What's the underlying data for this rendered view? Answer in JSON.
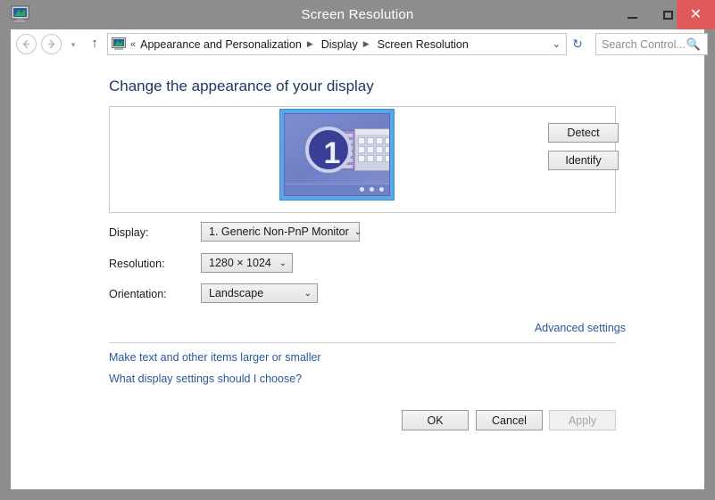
{
  "window": {
    "title": "Screen Resolution",
    "icon": "display-monitor-icon",
    "background_artifact": "........ ...... .. .",
    "controls": {
      "minimize_label": "Minimize",
      "maximize_label": "Maximize",
      "close_label": "✕",
      "close_color": "#e05a5a"
    }
  },
  "navbar": {
    "back_label": "◀",
    "forward_label": "▶",
    "recent_label": "▾",
    "up_label": "↑",
    "address_icon": "display-monitor-icon",
    "double_chevron": "«",
    "breadcrumbs": [
      "Appearance and Personalization",
      "Display",
      "Screen Resolution"
    ],
    "separator": "▶",
    "dropdown_arrow": "⌄",
    "refresh_label": "↻",
    "search": {
      "placeholder": "Search Control...",
      "value": "",
      "icon": "search-icon"
    }
  },
  "content": {
    "heading": "Change the appearance of your display",
    "preview": {
      "monitor_number": "1",
      "detect_label": "Detect",
      "identify_label": "Identify"
    },
    "fields": [
      {
        "label": "Display:",
        "value": "1. Generic Non-PnP Monitor",
        "arrow": "⌄"
      },
      {
        "label": "Resolution:",
        "value": "1280 × 1024",
        "arrow": "⌄"
      },
      {
        "label": "Orientation:",
        "value": "Landscape",
        "arrow": "⌄"
      }
    ],
    "links": {
      "advanced_settings": "Advanced settings",
      "make_text_larger": "Make text and other items larger or smaller",
      "what_display_settings": "What display settings should I choose?"
    },
    "link_color": "#2b5797",
    "heading_color": "#1f3864"
  },
  "buttons": {
    "ok": "OK",
    "cancel": "Cancel",
    "apply": "Apply",
    "apply_enabled": false
  }
}
